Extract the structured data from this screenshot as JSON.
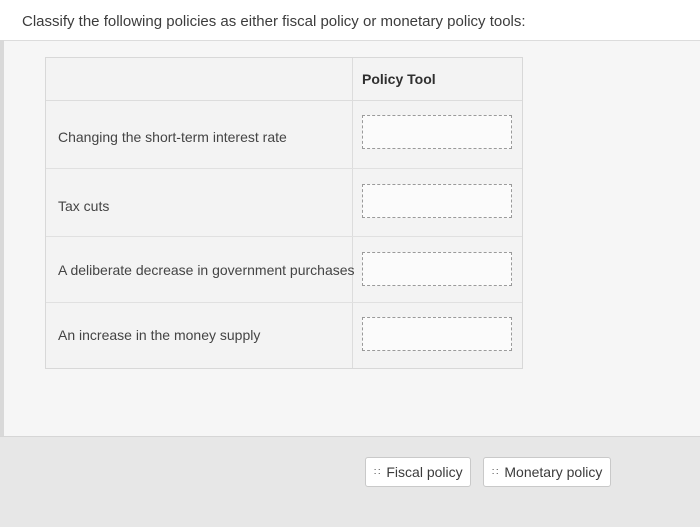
{
  "question": {
    "prompt": "Classify the following policies as either fiscal policy or monetary policy tools:"
  },
  "table": {
    "header": "Policy Tool",
    "rows": [
      {
        "label": "Changing the short-term interest rate"
      },
      {
        "label": "Tax cuts"
      },
      {
        "label": "A deliberate decrease in government purchases"
      },
      {
        "label": "An increase in the money supply"
      }
    ]
  },
  "options": [
    {
      "label": "Fiscal policy",
      "icon": "grip-dots-icon"
    },
    {
      "label": "Monetary policy",
      "icon": "grip-dots-icon"
    }
  ]
}
